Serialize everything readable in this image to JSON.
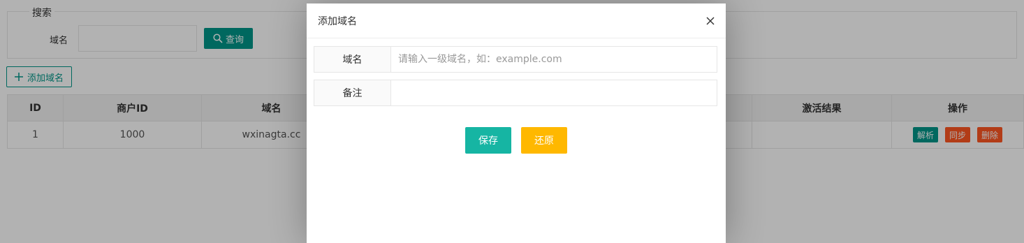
{
  "search": {
    "legend": "搜索",
    "domain_label": "域名",
    "domain_value": "",
    "query_label": "查询"
  },
  "toolbar": {
    "add_label": "添加域名"
  },
  "table": {
    "columns": [
      "ID",
      "商户ID",
      "域名",
      "",
      "激活结果",
      "操作"
    ],
    "rows": [
      {
        "id": "1",
        "merchant_id": "1000",
        "domain": "wxinagta.cc",
        "col4": "",
        "activation": "",
        "actions": [
          "解析",
          "同步",
          "删除"
        ]
      }
    ]
  },
  "modal": {
    "title": "添加域名",
    "fields": [
      {
        "label": "域名",
        "placeholder": "请输入一级域名，如：example.com",
        "value": ""
      },
      {
        "label": "备注",
        "placeholder": "",
        "value": ""
      }
    ],
    "save_label": "保存",
    "reset_label": "还原"
  },
  "colors": {
    "primary": "#009688",
    "save": "#16b5a3",
    "reset": "#FFB800",
    "danger": "#FF5722"
  }
}
